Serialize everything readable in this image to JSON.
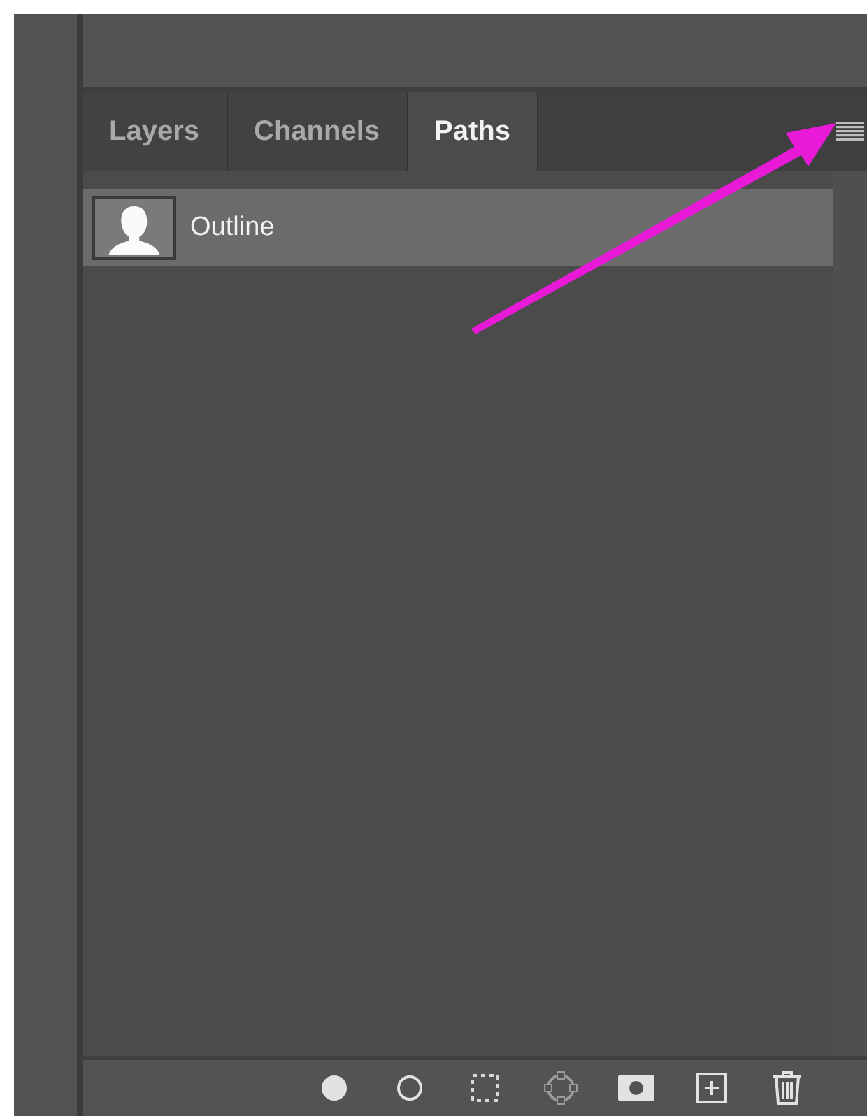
{
  "tabs": [
    {
      "label": "Layers",
      "selected": false
    },
    {
      "label": "Channels",
      "selected": false
    },
    {
      "label": "Paths",
      "selected": true
    }
  ],
  "paths": [
    {
      "name": "Outline",
      "selected": true
    }
  ],
  "annotation": {
    "kind": "arrow"
  }
}
